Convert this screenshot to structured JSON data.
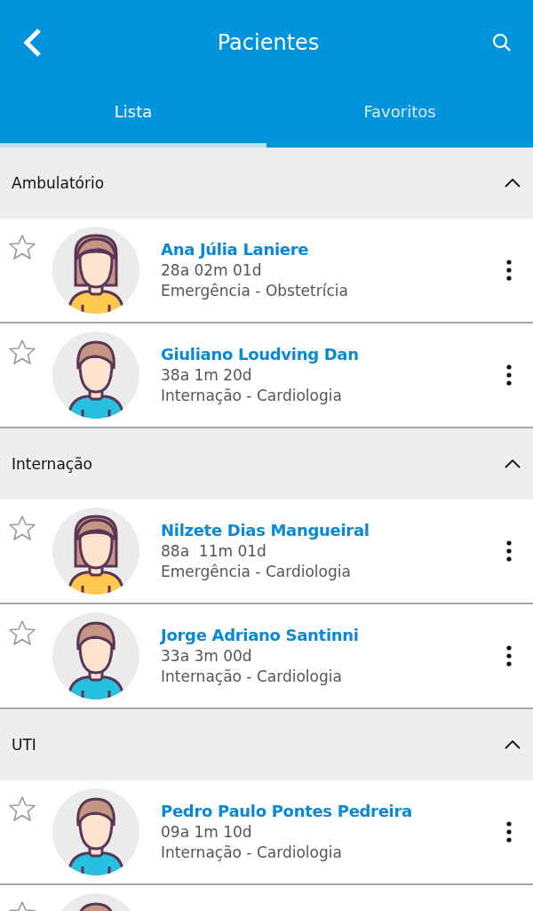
{
  "header": {
    "title": "Pacientes"
  },
  "tabs": [
    {
      "label": "Lista",
      "selected": true
    },
    {
      "label": "Favoritos",
      "selected": false
    }
  ],
  "sections": [
    {
      "title": "Ambulatório",
      "expanded": true,
      "patients": [
        {
          "name": "Ana Júlia Laniere",
          "age": "28a 02m 01d",
          "unit": "Emergência - Obstetrícia",
          "kind": "female",
          "favorite": false
        },
        {
          "name": "Giuliano Loudving Dan",
          "age": "38a 1m 20d",
          "unit": "Internação - Cardiologia",
          "kind": "male",
          "favorite": false
        }
      ]
    },
    {
      "title": "Internação",
      "expanded": true,
      "patients": [
        {
          "name": "Nilzete Dias Mangueiral",
          "age": "88a  11m 01d",
          "unit": "Emergência - Cardiologia",
          "kind": "female",
          "favorite": false
        },
        {
          "name": "Jorge Adriano Santinni",
          "age": "33a 3m 00d",
          "unit": "Internação - Cardiologia",
          "kind": "male",
          "favorite": false
        }
      ]
    },
    {
      "title": "UTI",
      "expanded": true,
      "patients": [
        {
          "name": "Pedro Paulo Pontes Pedreira",
          "age": "09a 1m 10d",
          "unit": "Internação - Cardiologia",
          "kind": "male",
          "favorite": false
        },
        {
          "kind": "male",
          "favorite": false
        }
      ]
    }
  ]
}
